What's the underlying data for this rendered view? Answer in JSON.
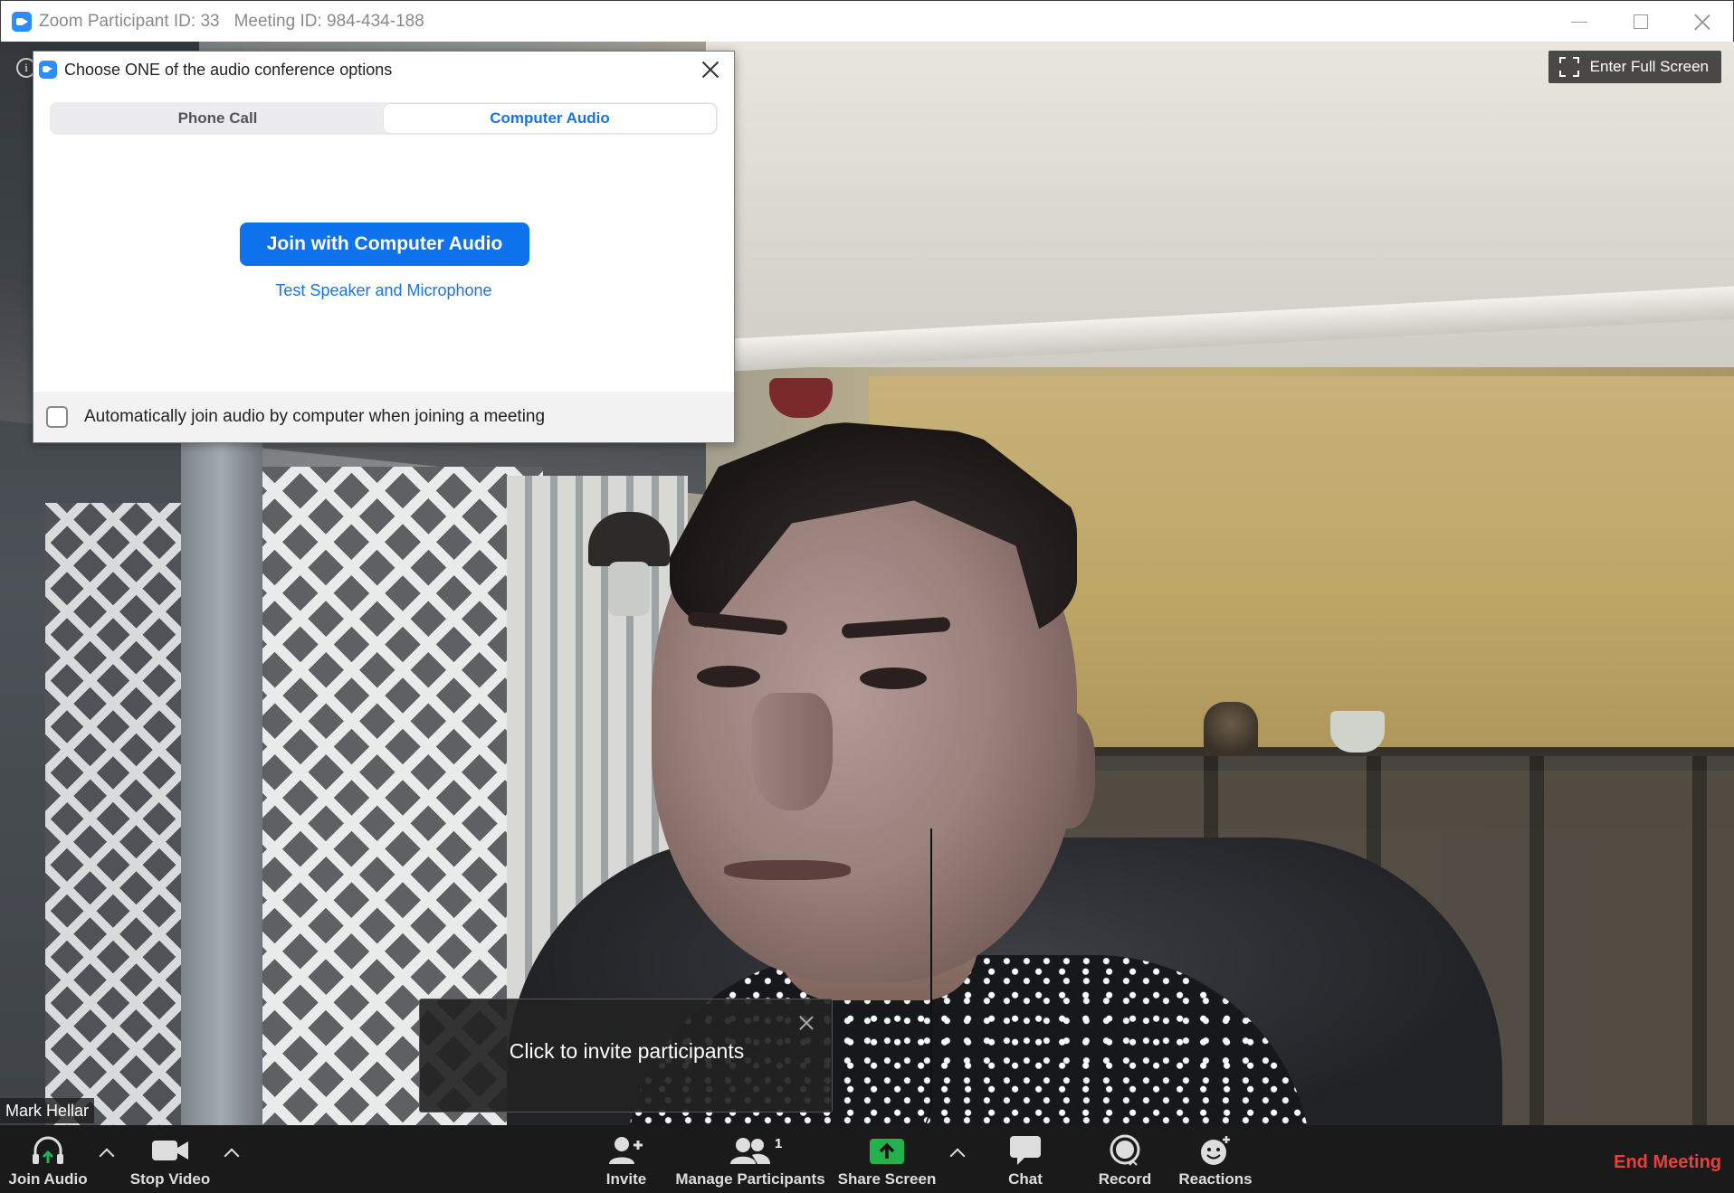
{
  "window": {
    "title": "Zoom Participant ID: 33",
    "meeting_id": "Meeting ID: 984-434-188"
  },
  "video": {
    "fullscreen_label": "Enter Full Screen",
    "participant_name": "Mark Hellar"
  },
  "audio_dialog": {
    "title": "Choose ONE of the audio conference options",
    "tabs": [
      {
        "label": "Phone Call",
        "active": false
      },
      {
        "label": "Computer Audio",
        "active": true
      }
    ],
    "join_button": "Join with Computer Audio",
    "test_link": "Test Speaker and Microphone",
    "auto_join_label": "Automatically join audio by computer when joining a meeting",
    "auto_join_checked": false
  },
  "toast": {
    "text": "Click to invite participants"
  },
  "toolbar": {
    "join_audio": "Join Audio",
    "stop_video": "Stop Video",
    "invite": "Invite",
    "manage_participants": "Manage Participants",
    "participant_count": "1",
    "share_screen": "Share Screen",
    "chat": "Chat",
    "record": "Record",
    "reactions": "Reactions",
    "end_meeting": "End Meeting"
  },
  "colors": {
    "accent": "#0e72ed",
    "share_green": "#23b14d",
    "end_red": "#e8403a"
  }
}
